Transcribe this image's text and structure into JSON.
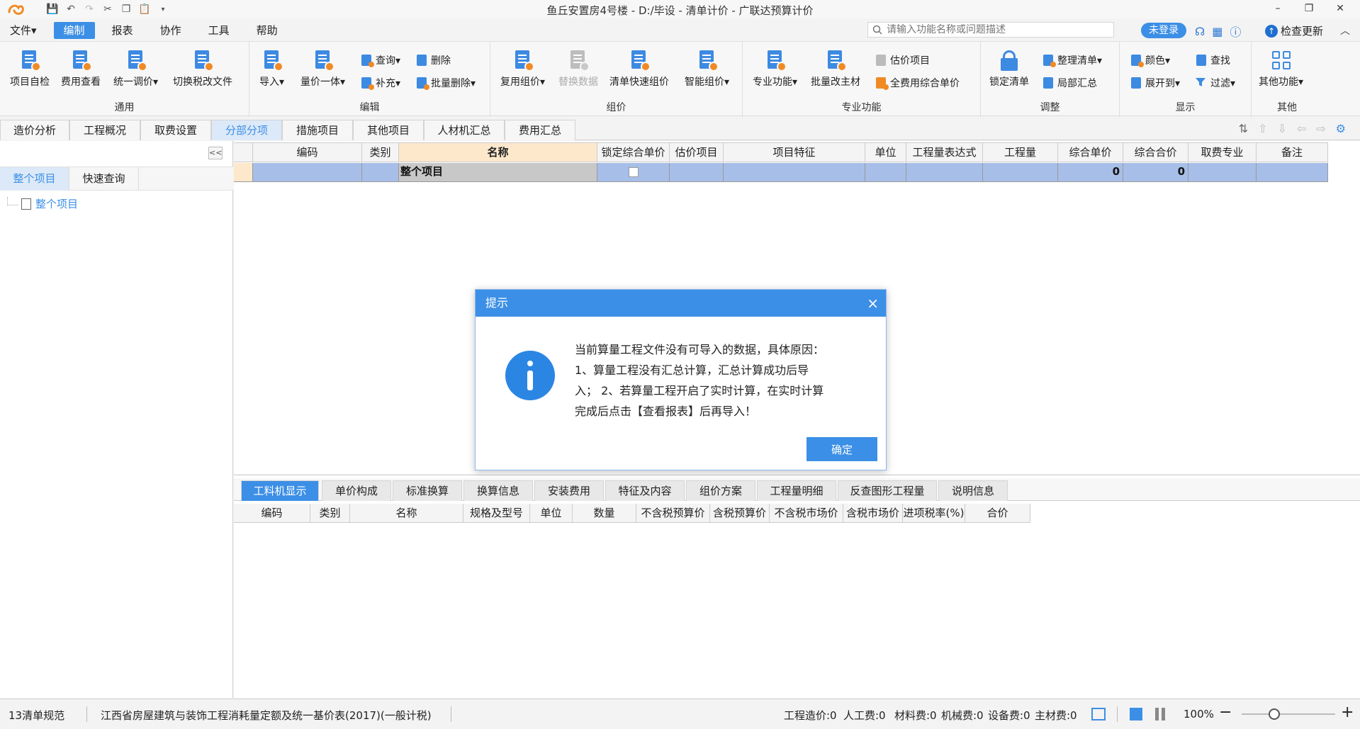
{
  "window": {
    "title": "鱼丘安置房4号楼 - D:/毕设 - 清单计价 - 广联达预算计价",
    "controls": [
      "–",
      "❐",
      "✕"
    ]
  },
  "menu": {
    "items": [
      "文件▾",
      "编制",
      "报表",
      "协作",
      "工具",
      "帮助"
    ],
    "search_placeholder": "请输入功能名称或问题描述",
    "login": "未登录",
    "check_update": "检查更新"
  },
  "ribbon": {
    "groups": {
      "general": "通用",
      "edit": "编辑",
      "pricing": "组价",
      "professional": "专业功能",
      "adjust": "调整",
      "display": "显示",
      "other": "其他"
    },
    "buttons": {
      "self_check": "项目自检",
      "fee_view": "费用查看",
      "unified_adjust": "统一调价▾",
      "switch_tax": "切换税改文件",
      "import": "导入▾",
      "qty_price": "量价一体▾",
      "query": "查询▾",
      "delete": "删除",
      "supplement": "补充▾",
      "batch_delete": "批量删除▾",
      "reuse": "复用组价▾",
      "replace_data": "替换数据",
      "quick_price": "清单快速组价",
      "smart_price": "智能组价▾",
      "prof_func": "专业功能▾",
      "batch_main": "批量改主材",
      "estimate_item": "估价项目",
      "all_fee": "全费用综合单价",
      "lock_list": "锁定清单",
      "tidy_list": "整理清单▾",
      "partial_sum": "局部汇总",
      "color": "颜色▾",
      "find": "查找",
      "expand": "展开到▾",
      "filter": "过滤▾",
      "other_func": "其他功能▾"
    }
  },
  "tabs": [
    "造价分析",
    "工程概况",
    "取费设置",
    "分部分项",
    "措施项目",
    "其他项目",
    "人材机汇总",
    "费用汇总"
  ],
  "left_panel": {
    "collapse": "<<",
    "tabs": [
      "整个项目",
      "快速查询"
    ],
    "tree_item": "整个项目"
  },
  "main_grid": {
    "columns": [
      "编码",
      "类别",
      "名称",
      "锁定综合单价",
      "估价项目",
      "项目特征",
      "单位",
      "工程量表达式",
      "工程量",
      "综合单价",
      "综合合价",
      "取费专业",
      "备注"
    ],
    "row": {
      "name": "整个项目",
      "unit_price": "0",
      "total": "0"
    }
  },
  "bottom_panel": {
    "tabs": [
      "工料机显示",
      "单价构成",
      "标准换算",
      "换算信息",
      "安装费用",
      "特征及内容",
      "组价方案",
      "工程量明细",
      "反查图形工程量",
      "说明信息"
    ],
    "columns": [
      "编码",
      "类别",
      "名称",
      "规格及型号",
      "单位",
      "数量",
      "不含税预算价",
      "含税预算价",
      "不含税市场价",
      "含税市场价",
      "进项税率(%)",
      "合价"
    ]
  },
  "status": {
    "spec": "13清单规范",
    "quota": "江西省房屋建筑与装饰工程消耗量定额及统一基价表(2017)(一般计税)",
    "cost": "工程造价:0",
    "labor": "人工费:0",
    "material": "材料费:0",
    "machine": "机械费:0",
    "equipment": "设备费:0",
    "main_material": "主材费:0",
    "zoom": "100%",
    "zoom_minus": "−",
    "zoom_plus": "+"
  },
  "dialog": {
    "title": "提示",
    "close": "×",
    "line1": "当前算量工程文件没有可导入的数据，具体原因：",
    "line2": "1、算量工程没有汇总计算，汇总计算成功后导",
    "line3": "入； 2、若算量工程开启了实时计算，在实时计算",
    "line4": "完成后点击【查看报表】后再导入！",
    "ok": "确定"
  },
  "colors": {
    "accent": "#3c8fe6",
    "row_select": "#a7bfe8",
    "header_highlight": "#fde8cc"
  }
}
